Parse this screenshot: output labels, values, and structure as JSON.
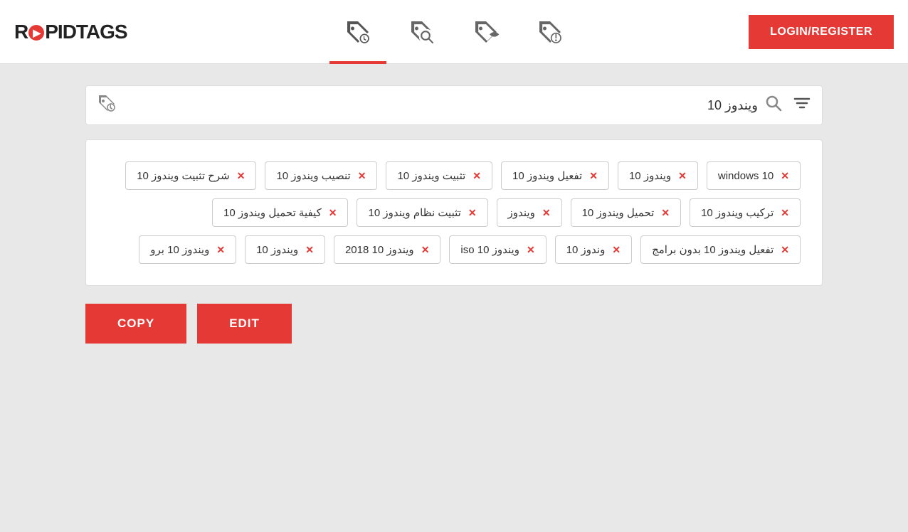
{
  "header": {
    "logo_text": "RAPIDTAGS",
    "nav_icons": [
      {
        "name": "tag-settings-icon",
        "label": "tag settings",
        "active": true
      },
      {
        "name": "tag-search-icon",
        "label": "tag search",
        "active": false
      },
      {
        "name": "tag-generate-icon",
        "label": "tag generate",
        "active": false
      },
      {
        "name": "tag-audit-icon",
        "label": "tag audit",
        "active": false
      }
    ],
    "login_label": "LOGIN/REGISTER"
  },
  "search": {
    "value": "ويندوز 10",
    "placeholder": "ويندوز 10"
  },
  "tags": [
    "windows 10",
    "ويندوز 10",
    "تفعيل ويندوز 10",
    "تثبيت ويندوز 10",
    "تنصيب ويندوز 10",
    "شرح تثبيت ويندوز 10",
    "تركيب ويندوز 10",
    "تحميل ويندوز 10",
    "ويندوز",
    "تثبيت نظام ويندوز 10",
    "كيفية تحميل ويندوز 10",
    "تفعيل ويندوز 10 بدون برامج",
    "وندوز 10",
    "ويندوز 10 iso",
    "ويندوز 10 2018",
    "ويندوز 10",
    "ويندوز 10 برو"
  ],
  "buttons": {
    "copy_label": "COPY",
    "edit_label": "EDIT"
  }
}
